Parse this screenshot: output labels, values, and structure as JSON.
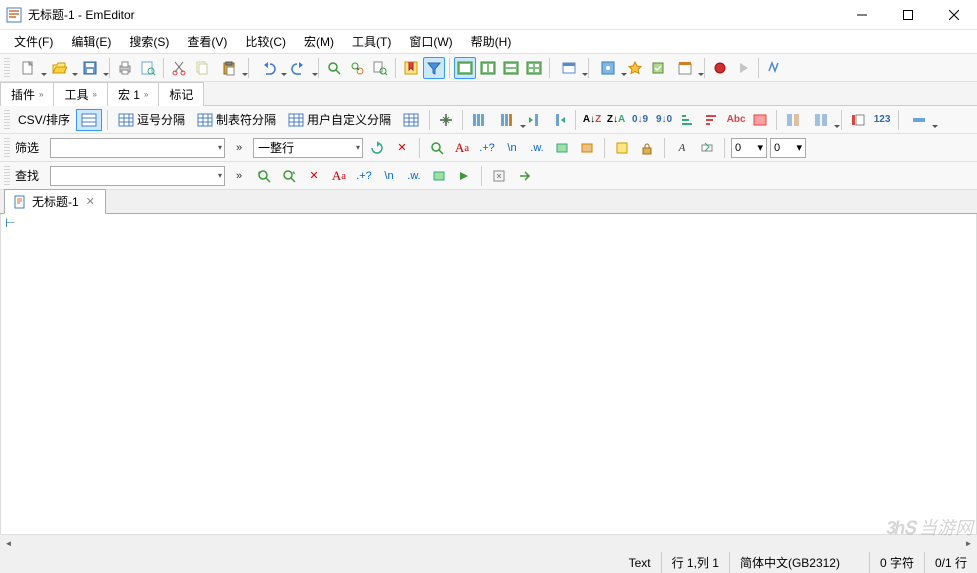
{
  "window": {
    "title": "无标题-1 - EmEditor"
  },
  "menu": {
    "file": "文件(F)",
    "edit": "编辑(E)",
    "search": "搜索(S)",
    "view": "查看(V)",
    "compare": "比较(C)",
    "macro": "宏(M)",
    "tools": "工具(T)",
    "window": "窗口(W)",
    "help": "帮助(H)"
  },
  "panel_tabs": {
    "plugins": "插件",
    "tools": "工具",
    "macro": "宏 1",
    "marks": "标记"
  },
  "csv": {
    "label": "CSV/排序",
    "comma": "逗号分隔",
    "tab": "制表符分隔",
    "user": "用户自定义分隔"
  },
  "filter": {
    "label": "筛选",
    "whole_line": "一整行",
    "zero": "0"
  },
  "find": {
    "label": "查找"
  },
  "doc_tab": {
    "name": "无标题-1"
  },
  "status": {
    "text": "Text",
    "pos": "行 1,列 1",
    "encoding": "简体中文(GB2312)",
    "chars": "0 字符",
    "lines": "0/1 行"
  },
  "watermark": "当游网"
}
